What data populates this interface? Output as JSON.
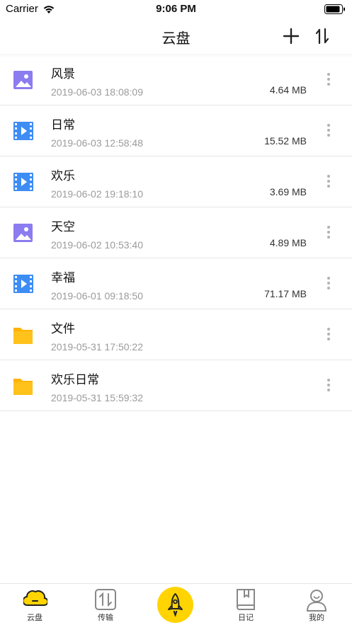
{
  "status_bar": {
    "carrier": "Carrier",
    "time": "9:06 PM"
  },
  "nav": {
    "title": "云盘"
  },
  "files": [
    {
      "name": "风景",
      "date": "2019-06-03 18:08:09",
      "size": "4.64 MB",
      "type": "image-icon"
    },
    {
      "name": "日常",
      "date": "2019-06-03 12:58:48",
      "size": "15.52 MB",
      "type": "video-icon"
    },
    {
      "name": "欢乐",
      "date": "2019-06-02 19:18:10",
      "size": "3.69 MB",
      "type": "video-icon"
    },
    {
      "name": "天空",
      "date": "2019-06-02 10:53:40",
      "size": "4.89 MB",
      "type": "image-icon"
    },
    {
      "name": "幸福",
      "date": "2019-06-01 09:18:50",
      "size": "71.17 MB",
      "type": "video-icon"
    },
    {
      "name": "文件",
      "date": "2019-05-31 17:50:22",
      "size": "",
      "type": "folder-icon"
    },
    {
      "name": "欢乐日常",
      "date": "2019-05-31 15:59:32",
      "size": "",
      "type": "folder-icon"
    }
  ],
  "tabs": [
    {
      "label": "云盘",
      "icon": "cloud-icon",
      "active": true
    },
    {
      "label": "传输",
      "icon": "transfer-icon",
      "active": false
    },
    {
      "label": "",
      "icon": "rocket-icon",
      "active": false
    },
    {
      "label": "日记",
      "icon": "diary-icon",
      "active": false
    },
    {
      "label": "我的",
      "icon": "profile-icon",
      "active": false
    }
  ],
  "colors": {
    "image_icon": "#8b7cf0",
    "video_icon": "#3d8df5",
    "folder_icon": "#ffc21a",
    "accent": "#ffd400",
    "date_text": "#9b9b9b"
  }
}
